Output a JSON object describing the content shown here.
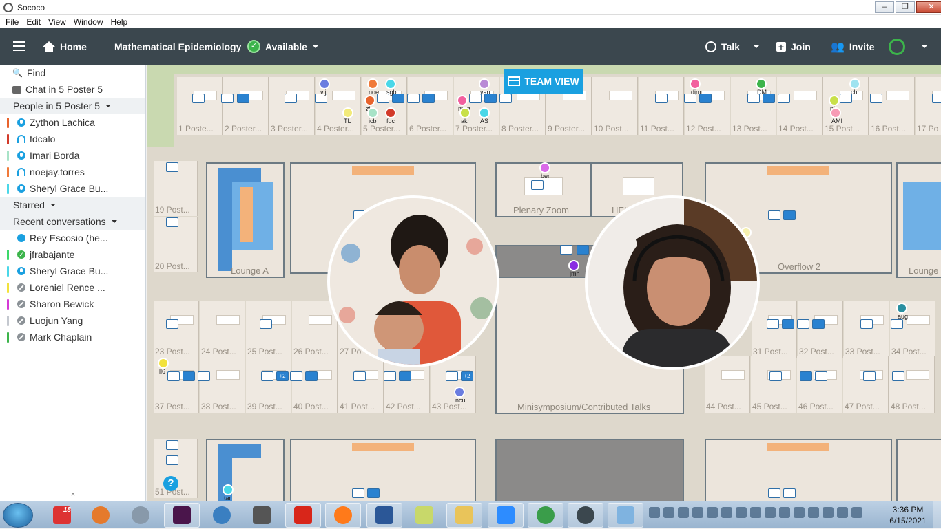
{
  "window": {
    "title": "Sococo",
    "controls": [
      "–",
      "❐",
      "✕"
    ]
  },
  "menu": [
    "File",
    "Edit",
    "View",
    "Window",
    "Help"
  ],
  "header": {
    "home": "Home",
    "org": "Mathematical Epidemiology",
    "status": "Available",
    "talk": "Talk",
    "join": "Join",
    "invite": "Invite"
  },
  "sidebar": {
    "find": "Find",
    "chat": "Chat in 5 Poster 5",
    "people_header": "People in 5 Poster 5",
    "people": [
      {
        "name": "Zython Lachica",
        "color": "#e8632c",
        "icon": "mic"
      },
      {
        "name": "fdcalo",
        "color": "#d23a2a",
        "icon": "headset"
      },
      {
        "name": "Imari Borda",
        "color": "#a8e3c7",
        "icon": "mic"
      },
      {
        "name": "noejay.torres",
        "color": "#f07a3a",
        "icon": "headset"
      },
      {
        "name": "Sheryl Grace Bu...",
        "color": "#4ad7e8",
        "icon": "mic"
      }
    ],
    "starred": "Starred",
    "recent_header": "Recent conversations",
    "recent": [
      {
        "name": "Rey Escosio (he...",
        "color": "#ffffff",
        "icon": "chat"
      },
      {
        "name": "jfrabajante",
        "color": "#3cd96a",
        "icon": "check"
      },
      {
        "name": "Sheryl Grace Bu...",
        "color": "#4ad7e8",
        "icon": "mic"
      },
      {
        "name": "Loreniel Rence ...",
        "color": "#f2e23c",
        "icon": "away"
      },
      {
        "name": "Sharon Bewick",
        "color": "#d53ad6",
        "icon": "away"
      },
      {
        "name": "Luojun Yang",
        "color": "#c4c8cf",
        "icon": "away"
      },
      {
        "name": "Mark Chaplain",
        "color": "#3cb44b",
        "icon": "away"
      }
    ]
  },
  "map": {
    "team_view": "TEAM VIEW",
    "top_posters": [
      "1 Poste...",
      "2 Poster...",
      "3 Poster...",
      "4 Poster...",
      "5 Poster...",
      "6 Poster...",
      "7 Poster...",
      "8 Poster...",
      "9 Poster...",
      "10 Post...",
      "11 Post...",
      "12 Post...",
      "13 Post...",
      "14 Post...",
      "15 Post...",
      "16 Post...",
      "17 Po"
    ],
    "left_posters": [
      "19 Post...",
      "20 Post..."
    ],
    "mid_posters": [
      "23 Post...",
      "24 Post...",
      "25 Post...",
      "26 Post...",
      "27 Po"
    ],
    "mid_right_posters": [
      "31 Post...",
      "32 Post...",
      "33 Post...",
      "34 Post..."
    ],
    "low_posters": [
      "37 Post...",
      "38 Post...",
      "39 Post...",
      "40 Post...",
      "41 Post...",
      "42 Post...",
      "43 Post..."
    ],
    "low_right_posters": [
      "44 Post...",
      "45 Post...",
      "46 Post...",
      "47 Post...",
      "48 Post..."
    ],
    "bottom_poster": "51 Post...",
    "rooms": {
      "lounge_a": "Lounge A",
      "plenary": "Plenary Zoom",
      "hei": "HEI",
      "overflow": "Overflow 2",
      "lounge": "Lounge",
      "minisymposium": "Minisymposium/Contributed Talks"
    },
    "users": [
      {
        "label": "vij",
        "color": "#6a7de0"
      },
      {
        "label": "noe",
        "color": "#f07a3a"
      },
      {
        "label": "sgb",
        "color": "#4ad7e8"
      },
      {
        "label": "TL",
        "color": "#f2ea7a"
      },
      {
        "label": "zl",
        "color": "#e8632c"
      },
      {
        "label": "icb",
        "color": "#a8e3c7"
      },
      {
        "label": "fdc",
        "color": "#d23a2a"
      },
      {
        "label": "mag",
        "color": "#f25f9e"
      },
      {
        "label": "van",
        "color": "#b98ad6"
      },
      {
        "label": "akh",
        "color": "#c9e04a"
      },
      {
        "label": "AS",
        "color": "#4ad7e8"
      },
      {
        "label": "dim",
        "color": "#f25f9e"
      },
      {
        "label": "DM",
        "color": "#3cb44b"
      },
      {
        "label": "chr",
        "color": "#9fe3f0"
      },
      {
        "label": "pl",
        "color": "#c9e04a"
      },
      {
        "label": "AMI",
        "color": "#f79bb5"
      },
      {
        "label": "ber",
        "color": "#d96ae8"
      },
      {
        "label": "jmh",
        "color": "#8a2be2"
      },
      {
        "label": "L",
        "color": "#f5f0b0"
      },
      {
        "label": "aug",
        "color": "#2a8fa0"
      },
      {
        "label": "ll6",
        "color": "#f2e23c"
      },
      {
        "label": "ncu",
        "color": "#6a7de0"
      },
      {
        "label": "tar",
        "color": "#4ad7e8"
      }
    ],
    "share_badge": "+2",
    "help": "?"
  },
  "taskbar": {
    "time": "3:36 PM",
    "date": "6/15/2021",
    "badges": [
      "18",
      "2",
      "15"
    ]
  }
}
